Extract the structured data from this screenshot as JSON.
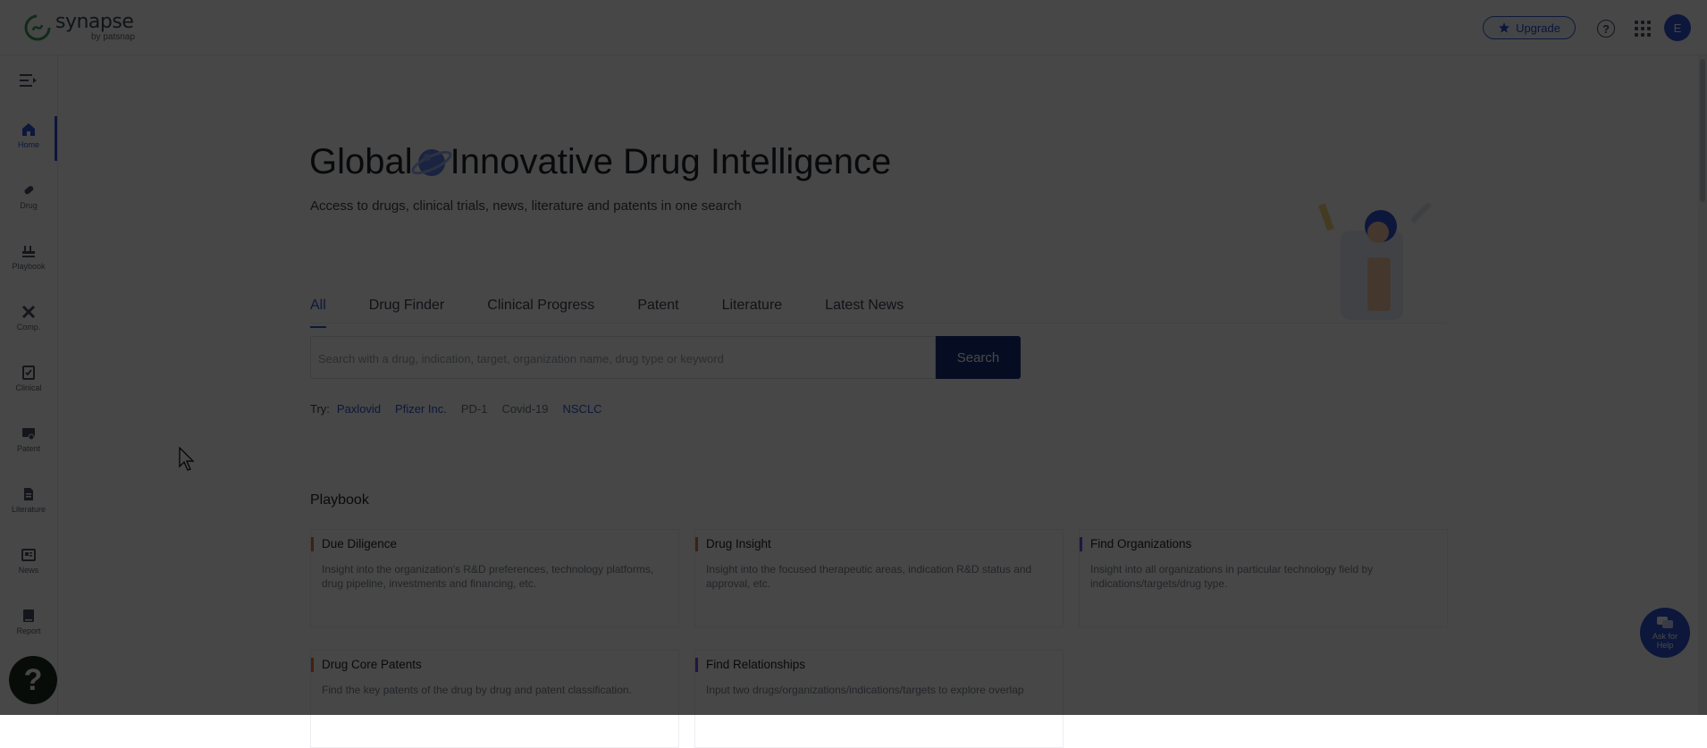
{
  "brand": {
    "name": "synapse",
    "sub": "by patsnap"
  },
  "header": {
    "upgrade_label": "Upgrade",
    "help_symbol": "?",
    "avatar_initial": "E"
  },
  "sidebar": {
    "items": [
      {
        "label": "Home",
        "icon": "home-icon"
      },
      {
        "label": "Drug",
        "icon": "pill-icon"
      },
      {
        "label": "Playbook",
        "icon": "playbook-icon"
      },
      {
        "label": "Comp.",
        "icon": "compare-icon"
      },
      {
        "label": "Clinical",
        "icon": "clinical-icon"
      },
      {
        "label": "Patent",
        "icon": "patent-icon"
      },
      {
        "label": "Literature",
        "icon": "literature-icon"
      },
      {
        "label": "News",
        "icon": "news-icon"
      },
      {
        "label": "Report",
        "icon": "report-icon"
      }
    ],
    "help_symbol": "?"
  },
  "hero": {
    "title_part1": "Global",
    "title_part2": "Innovative Drug Intelligence",
    "subtitle": "Access to drugs, clinical trials, news, literature and patents in one search"
  },
  "tabs": [
    "All",
    "Drug Finder",
    "Clinical Progress",
    "Patent",
    "Literature",
    "Latest News"
  ],
  "search": {
    "placeholder": "Search with a drug, indication, target, organization name, drug type or keyword",
    "button_label": "Search"
  },
  "try": {
    "label": "Try:",
    "chips": [
      "Paxlovid",
      "Pfizer Inc.",
      "PD-1",
      "Covid-19",
      "NSCLC"
    ]
  },
  "playbook": {
    "title": "Playbook",
    "cards": [
      {
        "title": "Due Diligence",
        "desc": "Insight into the organization's R&D preferences, technology platforms, drug pipeline, investments and financing, etc.",
        "accent": "#e8742b"
      },
      {
        "title": "Drug Insight",
        "desc": "Insight into the focused therapeutic areas, indication R&D status and approval, etc.",
        "accent": "#e8742b"
      },
      {
        "title": "Find Organizations",
        "desc": "Insight into all organizations in particular technology field by indications/targets/drug type.",
        "accent": "#7b4fe0"
      },
      {
        "title": "Drug Core Patents",
        "desc": "Find the key patents of the drug by drug and patent classification.",
        "accent": "#e8742b"
      },
      {
        "title": "Find Relationships",
        "desc": "Input two drugs/organizations/indications/targets to explore overlap",
        "accent": "#7b4fe0"
      }
    ]
  },
  "ask_help": {
    "line1": "Ask for",
    "line2": "Help"
  },
  "colors": {
    "primary": "#2f55d4",
    "search_button": "#16307f",
    "overlay": "rgba(0,0,0,0.72)"
  }
}
